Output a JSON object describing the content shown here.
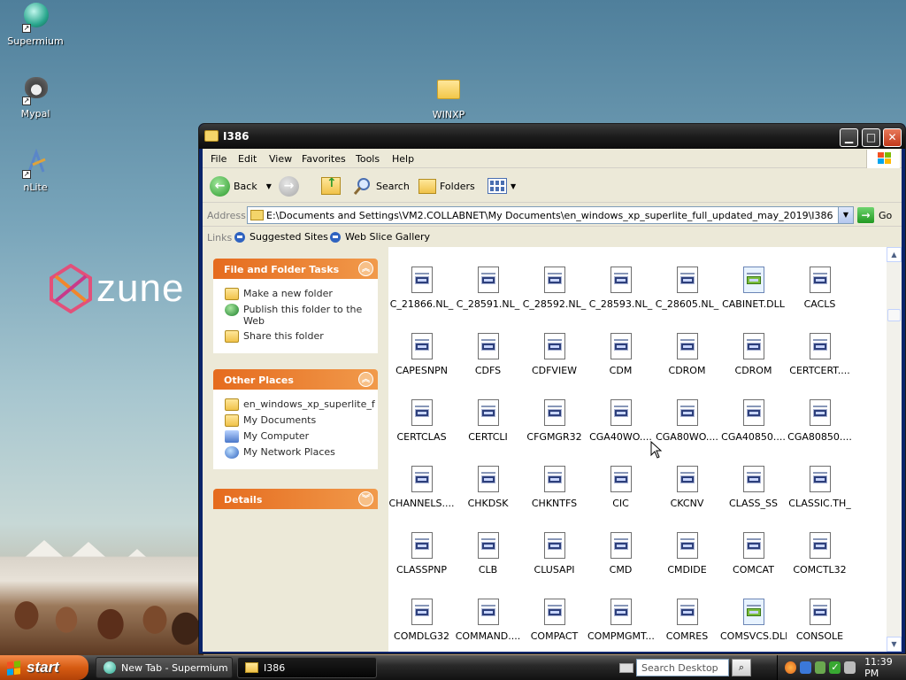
{
  "desktop": {
    "icons": [
      {
        "label": "Supermium"
      },
      {
        "label": "Mypal"
      },
      {
        "label": "nLite"
      },
      {
        "label": "WINXP"
      }
    ],
    "wallpaper_logo": "zune"
  },
  "window": {
    "title": "I386",
    "menu": [
      "File",
      "Edit",
      "View",
      "Favorites",
      "Tools",
      "Help"
    ],
    "toolbar": {
      "back_label": "Back",
      "search_label": "Search",
      "folders_label": "Folders"
    },
    "address": {
      "label": "Address",
      "value": "E:\\Documents and Settings\\VM2.COLLABNET\\My Documents\\en_windows_xp_superlite_full_updated_may_2019\\I386",
      "go_label": "Go"
    },
    "links": {
      "label": "Links",
      "items": [
        "Suggested Sites",
        "Web Slice Gallery"
      ]
    },
    "tasks": {
      "file_folder": {
        "title": "File and Folder Tasks",
        "items": [
          "Make a new folder",
          "Publish this folder to the Web",
          "Share this folder"
        ]
      },
      "other_places": {
        "title": "Other Places",
        "items": [
          "en_windows_xp_superlite_f",
          "My Documents",
          "My Computer",
          "My Network Places"
        ]
      },
      "details": {
        "title": "Details"
      }
    },
    "files": [
      {
        "name": "C_21866.NL_",
        "icon": "system-file-icon"
      },
      {
        "name": "C_28591.NL_",
        "icon": "system-file-icon"
      },
      {
        "name": "C_28592.NL_",
        "icon": "system-file-icon"
      },
      {
        "name": "C_28593.NL_",
        "icon": "system-file-icon"
      },
      {
        "name": "C_28605.NL_",
        "icon": "system-file-icon"
      },
      {
        "name": "CABINET.DLL",
        "icon": "dll-file-icon"
      },
      {
        "name": "CACLS",
        "icon": "system-file-icon"
      },
      {
        "name": "CAPESNPN",
        "icon": "system-file-icon"
      },
      {
        "name": "CDFS",
        "icon": "system-file-icon"
      },
      {
        "name": "CDFVIEW",
        "icon": "system-file-icon"
      },
      {
        "name": "CDM",
        "icon": "system-file-icon"
      },
      {
        "name": "CDROM",
        "icon": "system-file-icon"
      },
      {
        "name": "CDROM",
        "icon": "system-file-icon"
      },
      {
        "name": "CERTCERT....",
        "icon": "system-file-icon"
      },
      {
        "name": "CERTCLAS",
        "icon": "system-file-icon"
      },
      {
        "name": "CERTCLI",
        "icon": "system-file-icon"
      },
      {
        "name": "CFGMGR32",
        "icon": "system-file-icon"
      },
      {
        "name": "CGA40WO....",
        "icon": "system-file-icon"
      },
      {
        "name": "CGA80WO....",
        "icon": "system-file-icon"
      },
      {
        "name": "CGA40850....",
        "icon": "system-file-icon"
      },
      {
        "name": "CGA80850....",
        "icon": "system-file-icon"
      },
      {
        "name": "CHANNELS....",
        "icon": "system-file-icon"
      },
      {
        "name": "CHKDSK",
        "icon": "system-file-icon"
      },
      {
        "name": "CHKNTFS",
        "icon": "system-file-icon"
      },
      {
        "name": "CIC",
        "icon": "system-file-icon"
      },
      {
        "name": "CKCNV",
        "icon": "system-file-icon"
      },
      {
        "name": "CLASS_SS",
        "icon": "system-file-icon"
      },
      {
        "name": "CLASSIC.TH_",
        "icon": "system-file-icon"
      },
      {
        "name": "CLASSPNP",
        "icon": "system-file-icon"
      },
      {
        "name": "CLB",
        "icon": "system-file-icon"
      },
      {
        "name": "CLUSAPI",
        "icon": "system-file-icon"
      },
      {
        "name": "CMD",
        "icon": "system-file-icon"
      },
      {
        "name": "CMDIDE",
        "icon": "system-file-icon"
      },
      {
        "name": "COMCAT",
        "icon": "system-file-icon"
      },
      {
        "name": "COMCTL32",
        "icon": "system-file-icon"
      },
      {
        "name": "COMDLG32",
        "icon": "system-file-icon"
      },
      {
        "name": "COMMAND....",
        "icon": "system-file-icon"
      },
      {
        "name": "COMPACT",
        "icon": "system-file-icon"
      },
      {
        "name": "COMPMGMT....",
        "icon": "system-file-icon"
      },
      {
        "name": "COMRES",
        "icon": "system-file-icon"
      },
      {
        "name": "COMSVCS.DLL",
        "icon": "dll-file-icon"
      },
      {
        "name": "CONSOLE",
        "icon": "system-file-icon"
      }
    ]
  },
  "taskbar": {
    "start_label": "start",
    "buttons": [
      {
        "label": "New Tab - Supermium",
        "icon": "browser-icon"
      },
      {
        "label": "I386",
        "icon": "folder-icon"
      }
    ],
    "search_placeholder": "Search Desktop",
    "clock": "11:39 PM"
  },
  "colors": {
    "taskpane_header": "#e56b1e",
    "start_button": "#d65b12",
    "titlebar": "#1c1c1c"
  }
}
